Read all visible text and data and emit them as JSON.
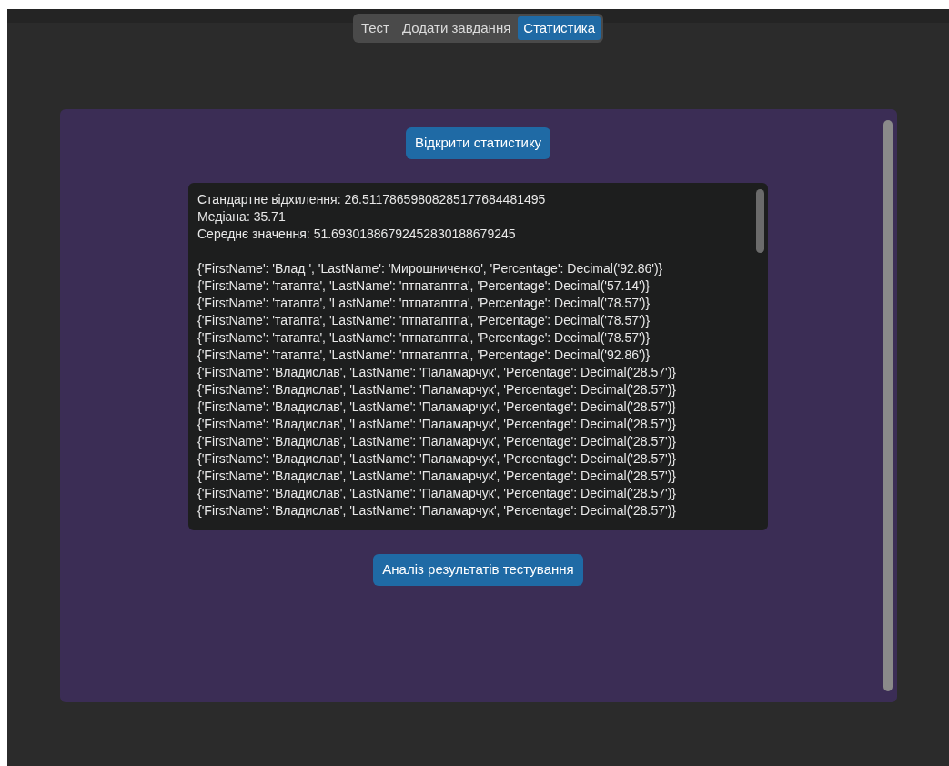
{
  "tabs": [
    {
      "label": "Тест",
      "selected": false
    },
    {
      "label": "Додати завдання",
      "selected": false
    },
    {
      "label": "Статистика",
      "selected": true
    }
  ],
  "open_button": "Відкрити статистику",
  "output": {
    "summary": [
      "Стандартне відхилення: 26.51178659808285177684481495",
      "Медіана: 35.71",
      "Середнє значення: 51.69301886792452830188679245"
    ],
    "records": [
      "{'FirstName': 'Влад ', 'LastName': 'Мирошниченко', 'Percentage': Decimal('92.86')}",
      "{'FirstName': 'татапта', 'LastName': 'птпатаптпа', 'Percentage': Decimal('57.14')}",
      "{'FirstName': 'татапта', 'LastName': 'птпатаптпа', 'Percentage': Decimal('78.57')}",
      "{'FirstName': 'татапта', 'LastName': 'птпатаптпа', 'Percentage': Decimal('78.57')}",
      "{'FirstName': 'татапта', 'LastName': 'птпатаптпа', 'Percentage': Decimal('78.57')}",
      "{'FirstName': 'татапта', 'LastName': 'птпатаптпа', 'Percentage': Decimal('92.86')}",
      "{'FirstName': 'Владислав', 'LastName': 'Паламарчук', 'Percentage': Decimal('28.57')}",
      "{'FirstName': 'Владислав', 'LastName': 'Паламарчук', 'Percentage': Decimal('28.57')}",
      "{'FirstName': 'Владислав', 'LastName': 'Паламарчук', 'Percentage': Decimal('28.57')}",
      "{'FirstName': 'Владислав', 'LastName': 'Паламарчук', 'Percentage': Decimal('28.57')}",
      "{'FirstName': 'Владислав', 'LastName': 'Паламарчук', 'Percentage': Decimal('28.57')}",
      "{'FirstName': 'Владислав', 'LastName': 'Паламарчук', 'Percentage': Decimal('28.57')}",
      "{'FirstName': 'Владислав', 'LastName': 'Паламарчук', 'Percentage': Decimal('28.57')}",
      "{'FirstName': 'Владислав', 'LastName': 'Паламарчук', 'Percentage': Decimal('28.57')}",
      "{'FirstName': 'Владислав', 'LastName': 'Паламарчук', 'Percentage': Decimal('28.57')}"
    ]
  },
  "analyze_button": "Аналіз результатів тестування"
}
